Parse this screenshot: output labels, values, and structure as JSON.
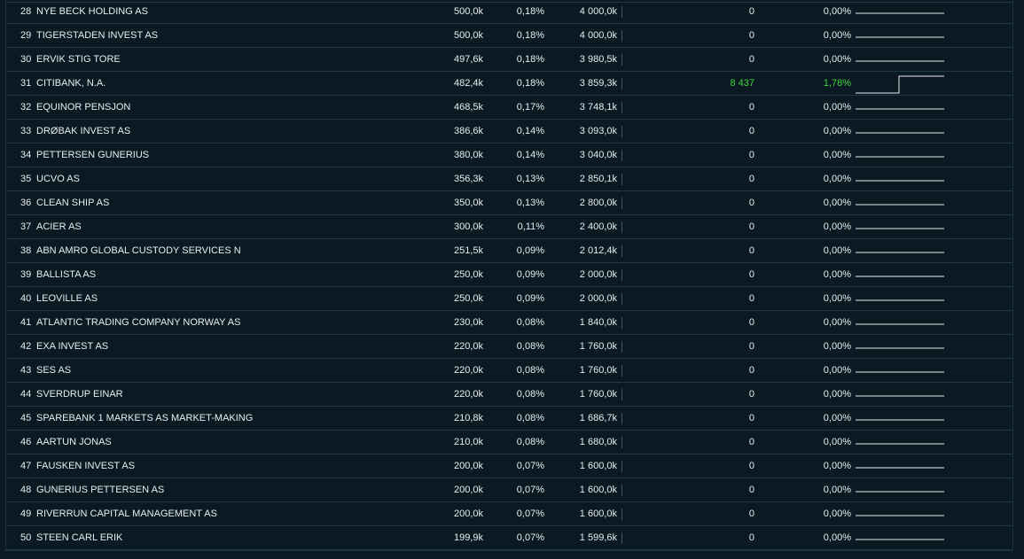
{
  "colors": {
    "background": "#0b1a22",
    "row_border": "#1e3a46",
    "text": "#e6edf2",
    "positive": "#3fd43f",
    "sparkline": "#e6edf2"
  },
  "rows": [
    {
      "rank": "28",
      "name": "NYE BECK HOLDING AS",
      "shares": "500,0k",
      "pct": "0,18%",
      "value": "4 000,0k",
      "change": "0",
      "change_pct": "0,00%",
      "spark_step": 0
    },
    {
      "rank": "29",
      "name": "TIGERSTADEN INVEST AS",
      "shares": "500,0k",
      "pct": "0,18%",
      "value": "4 000,0k",
      "change": "0",
      "change_pct": "0,00%",
      "spark_step": 0
    },
    {
      "rank": "30",
      "name": "ERVIK STIG TORE",
      "shares": "497,6k",
      "pct": "0,18%",
      "value": "3 980,5k",
      "change": "0",
      "change_pct": "0,00%",
      "spark_step": 0
    },
    {
      "rank": "31",
      "name": "CITIBANK, N.A.",
      "shares": "482,4k",
      "pct": "0,18%",
      "value": "3 859,3k",
      "change": "8 437",
      "change_pct": "1,78%",
      "spark_step": 1,
      "positive": true
    },
    {
      "rank": "32",
      "name": "EQUINOR PENSJON",
      "shares": "468,5k",
      "pct": "0,17%",
      "value": "3 748,1k",
      "change": "0",
      "change_pct": "0,00%",
      "spark_step": 0
    },
    {
      "rank": "33",
      "name": "DRØBAK INVEST AS",
      "shares": "386,6k",
      "pct": "0,14%",
      "value": "3 093,0k",
      "change": "0",
      "change_pct": "0,00%",
      "spark_step": 0
    },
    {
      "rank": "34",
      "name": "PETTERSEN GUNERIUS",
      "shares": "380,0k",
      "pct": "0,14%",
      "value": "3 040,0k",
      "change": "0",
      "change_pct": "0,00%",
      "spark_step": 0
    },
    {
      "rank": "35",
      "name": "UCVO AS",
      "shares": "356,3k",
      "pct": "0,13%",
      "value": "2 850,1k",
      "change": "0",
      "change_pct": "0,00%",
      "spark_step": 0
    },
    {
      "rank": "36",
      "name": "CLEAN SHIP AS",
      "shares": "350,0k",
      "pct": "0,13%",
      "value": "2 800,0k",
      "change": "0",
      "change_pct": "0,00%",
      "spark_step": 0
    },
    {
      "rank": "37",
      "name": "ACIER AS",
      "shares": "300,0k",
      "pct": "0,11%",
      "value": "2 400,0k",
      "change": "0",
      "change_pct": "0,00%",
      "spark_step": 0
    },
    {
      "rank": "38",
      "name": "ABN AMRO GLOBAL CUSTODY SERVICES N",
      "shares": "251,5k",
      "pct": "0,09%",
      "value": "2 012,4k",
      "change": "0",
      "change_pct": "0,00%",
      "spark_step": 0
    },
    {
      "rank": "39",
      "name": "BALLISTA AS",
      "shares": "250,0k",
      "pct": "0,09%",
      "value": "2 000,0k",
      "change": "0",
      "change_pct": "0,00%",
      "spark_step": 0
    },
    {
      "rank": "40",
      "name": "LEOVILLE AS",
      "shares": "250,0k",
      "pct": "0,09%",
      "value": "2 000,0k",
      "change": "0",
      "change_pct": "0,00%",
      "spark_step": 0
    },
    {
      "rank": "41",
      "name": "ATLANTIC TRADING COMPANY NORWAY AS",
      "shares": "230,0k",
      "pct": "0,08%",
      "value": "1 840,0k",
      "change": "0",
      "change_pct": "0,00%",
      "spark_step": 0
    },
    {
      "rank": "42",
      "name": "EXA INVEST AS",
      "shares": "220,0k",
      "pct": "0,08%",
      "value": "1 760,0k",
      "change": "0",
      "change_pct": "0,00%",
      "spark_step": 0
    },
    {
      "rank": "43",
      "name": "SES AS",
      "shares": "220,0k",
      "pct": "0,08%",
      "value": "1 760,0k",
      "change": "0",
      "change_pct": "0,00%",
      "spark_step": 0
    },
    {
      "rank": "44",
      "name": "SVERDRUP EINAR",
      "shares": "220,0k",
      "pct": "0,08%",
      "value": "1 760,0k",
      "change": "0",
      "change_pct": "0,00%",
      "spark_step": 0
    },
    {
      "rank": "45",
      "name": "SPAREBANK 1 MARKETS AS MARKET-MAKING",
      "shares": "210,8k",
      "pct": "0,08%",
      "value": "1 686,7k",
      "change": "0",
      "change_pct": "0,00%",
      "spark_step": 0
    },
    {
      "rank": "46",
      "name": "AARTUN JONAS",
      "shares": "210,0k",
      "pct": "0,08%",
      "value": "1 680,0k",
      "change": "0",
      "change_pct": "0,00%",
      "spark_step": 0
    },
    {
      "rank": "47",
      "name": "FAUSKEN INVEST AS",
      "shares": "200,0k",
      "pct": "0,07%",
      "value": "1 600,0k",
      "change": "0",
      "change_pct": "0,00%",
      "spark_step": 0
    },
    {
      "rank": "48",
      "name": "GUNERIUS PETTERSEN AS",
      "shares": "200,0k",
      "pct": "0,07%",
      "value": "1 600,0k",
      "change": "0",
      "change_pct": "0,00%",
      "spark_step": 0
    },
    {
      "rank": "49",
      "name": "RIVERRUN CAPITAL MANAGEMENT AS",
      "shares": "200,0k",
      "pct": "0,07%",
      "value": "1 600,0k",
      "change": "0",
      "change_pct": "0,00%",
      "spark_step": 0
    },
    {
      "rank": "50",
      "name": "STEEN CARL ERIK",
      "shares": "199,9k",
      "pct": "0,07%",
      "value": "1 599,6k",
      "change": "0",
      "change_pct": "0,00%",
      "spark_step": 0
    }
  ]
}
